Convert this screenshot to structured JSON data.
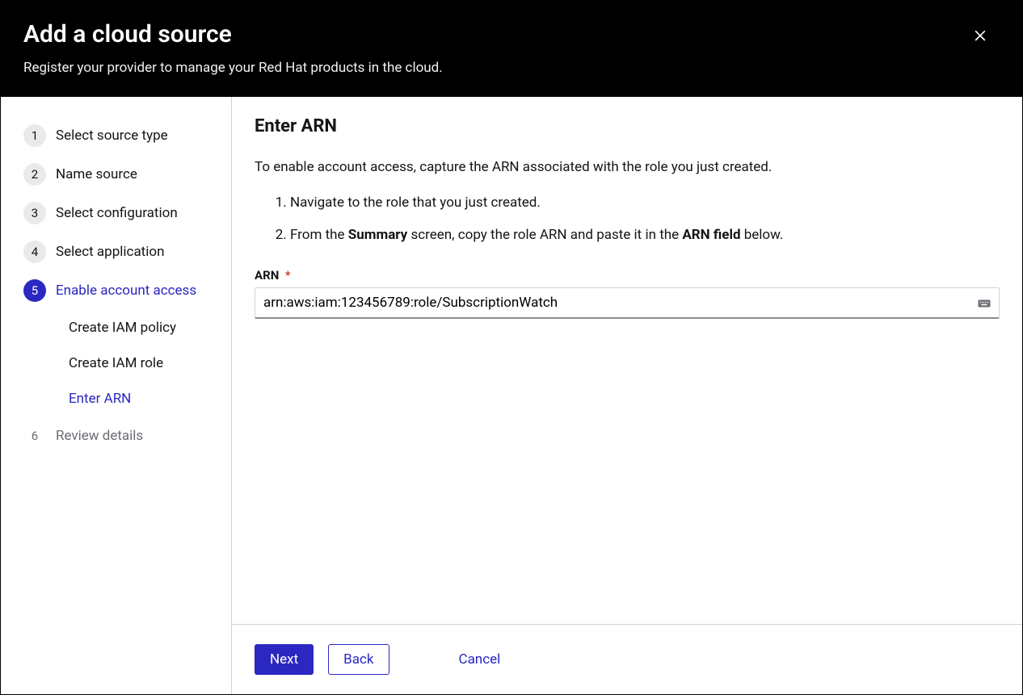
{
  "header": {
    "title": "Add a cloud source",
    "subtitle": "Register your provider to manage your Red Hat products in the cloud."
  },
  "sidebar": {
    "steps": [
      {
        "num": "1",
        "label": "Select source type"
      },
      {
        "num": "2",
        "label": "Name source"
      },
      {
        "num": "3",
        "label": "Select configuration"
      },
      {
        "num": "4",
        "label": "Select application"
      },
      {
        "num": "5",
        "label": "Enable account access"
      },
      {
        "num": "6",
        "label": "Review details"
      }
    ],
    "substeps": [
      {
        "label": "Create IAM policy"
      },
      {
        "label": "Create IAM role"
      },
      {
        "label": "Enter ARN"
      }
    ]
  },
  "main": {
    "heading": "Enter ARN",
    "intro": "To enable account access, capture the ARN associated with the role you just created.",
    "step1": "Navigate to the role that you just created.",
    "step2_a": "From the ",
    "step2_b": "Summary",
    "step2_c": " screen, copy the role ARN and paste it in the ",
    "step2_d": "ARN field",
    "step2_e": " below.",
    "arn_label": "ARN",
    "required_mark": "*",
    "arn_value": "arn:aws:iam:123456789:role/SubscriptionWatch"
  },
  "footer": {
    "next": "Next",
    "back": "Back",
    "cancel": "Cancel"
  }
}
